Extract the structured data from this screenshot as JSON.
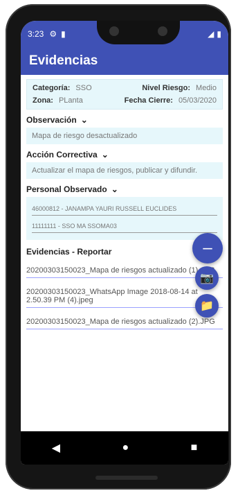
{
  "status": {
    "time": "3:23",
    "icons": [
      "gear-icon",
      "lock-icon"
    ],
    "signal": "◢",
    "battery": "▮"
  },
  "app": {
    "title": "Evidencias"
  },
  "details": {
    "categoria_label": "Categoría:",
    "categoria_value": "SSO",
    "nivel_label": "Nivel Riesgo:",
    "nivel_value": "Medio",
    "zona_label": "Zona:",
    "zona_value": "PLanta",
    "fecha_label": "Fecha Cierre:",
    "fecha_value": "05/03/2020"
  },
  "observacion": {
    "title": "Observación",
    "text": "Mapa de riesgo desactualizado"
  },
  "accion": {
    "title": "Acción Correctiva",
    "text": "Actualizar el mapa de riesgos, publicar y difundir."
  },
  "personal": {
    "title": "Personal Observado",
    "lines": [
      "46000812 - JANAMPA YAURI RUSSELL EUCLIDES",
      "11111111 - SSO MA SSOMA03"
    ]
  },
  "evidencias": {
    "title": "Evidencias - Reportar",
    "files": [
      "20200303150023_Mapa de riesgos actualizado (1).JPG",
      "20200303150023_WhatsApp Image 2018-08-14 at 2.50.39 PM (4).jpeg",
      "20200303150023_Mapa de riesgos actualizado (2).JPG"
    ]
  },
  "fab": {
    "main_icon": "–",
    "camera_icon": "📷",
    "folder_icon": "📁"
  },
  "nav": {
    "back": "◀",
    "home": "●",
    "recents": "■"
  }
}
